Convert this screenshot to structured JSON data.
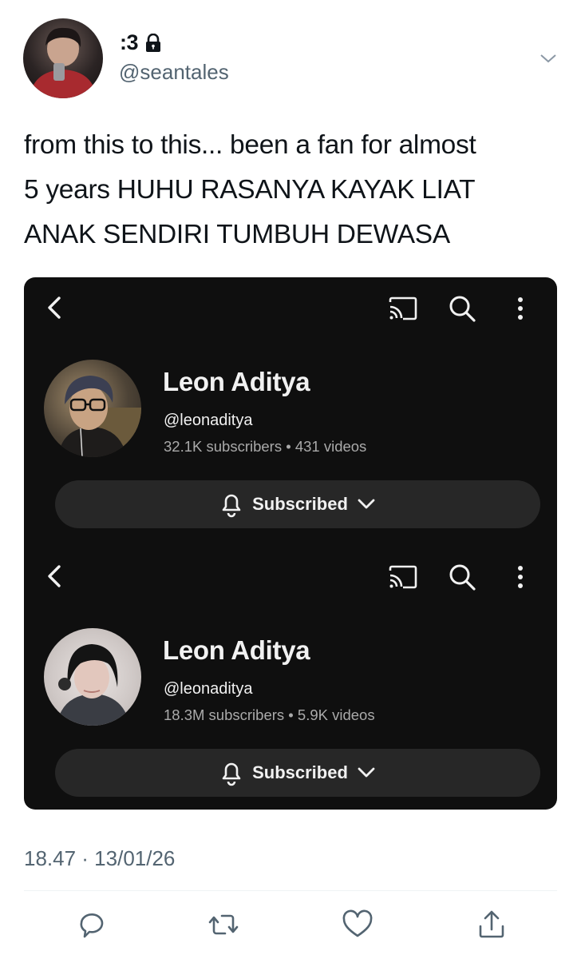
{
  "tweet": {
    "author": {
      "display_name": ":3",
      "handle": "@seantales",
      "locked": true
    },
    "text": "from this to this... been a fan for almost\n5 years HUHU RASANYA KAYAK LIAT\nANAK SENDIRI TUMBUH DEWASA",
    "timestamp": "18.47 · 13/01/26"
  },
  "media": {
    "panels": [
      {
        "channel_name": "Leon Aditya",
        "channel_handle": "@leonaditya",
        "stats": "32.1K subscribers  •  431 videos",
        "subscribe_label": "Subscribed"
      },
      {
        "channel_name": "Leon Aditya",
        "channel_handle": "@leonaditya",
        "stats": "18.3M subscribers  •  5.9K videos",
        "subscribe_label": "Subscribed"
      }
    ]
  },
  "icons": {
    "header": [
      "lock-icon",
      "chevron-down-icon"
    ],
    "youtube_toolbar": [
      "back-arrow-icon",
      "cast-icon",
      "search-icon",
      "more-vertical-icon"
    ],
    "actions": [
      "reply-icon",
      "retweet-icon",
      "like-icon",
      "share-icon"
    ]
  },
  "colors": {
    "text_primary": "#0f1419",
    "text_secondary": "#536471",
    "media_background": "#0f0f0f",
    "button_background": "#272727"
  }
}
